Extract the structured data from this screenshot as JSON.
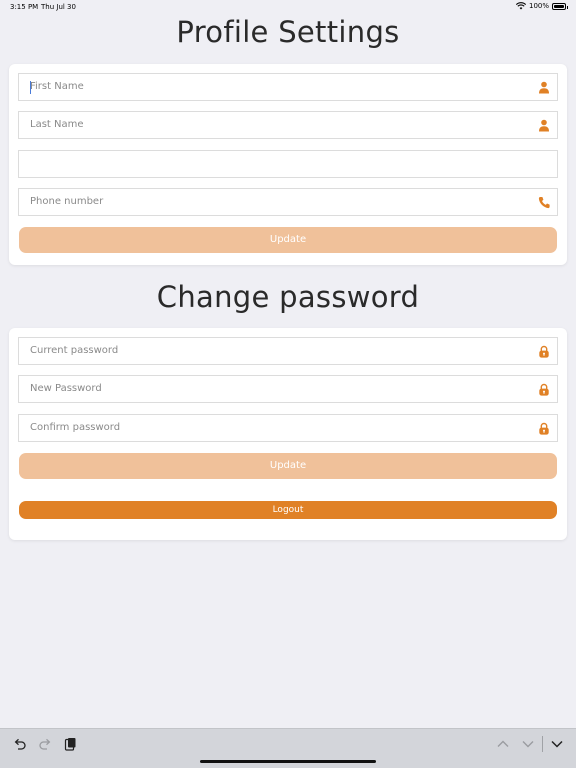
{
  "status_bar": {
    "time": "3:15 PM",
    "date": "Thu Jul 30",
    "battery": "100%"
  },
  "profile": {
    "title": "Profile Settings",
    "first_name_placeholder": "First Name",
    "last_name_placeholder": "Last Name",
    "email_value": "",
    "phone_placeholder": "Phone number",
    "update_label": "Update"
  },
  "password": {
    "title": "Change password",
    "current_placeholder": "Current password",
    "new_placeholder": "New Password",
    "confirm_placeholder": "Confirm password",
    "update_label": "Update",
    "logout_label": "Logout"
  },
  "icons": {
    "first_name": "user-icon",
    "last_name": "user-icon",
    "phone": "phone-icon",
    "current_password": "lock-icon",
    "new_password": "lock-icon",
    "confirm_password": "lock-icon",
    "undo": "undo-icon",
    "redo": "redo-icon",
    "paste": "paste-icon",
    "prev": "chevron-up-icon",
    "next": "chevron-down-icon",
    "dismiss": "keyboard-dismiss-icon"
  },
  "colors": {
    "accent": "#e08126",
    "accent_soft": "#f0c19a",
    "background": "#efeff4",
    "card": "#ffffff"
  }
}
